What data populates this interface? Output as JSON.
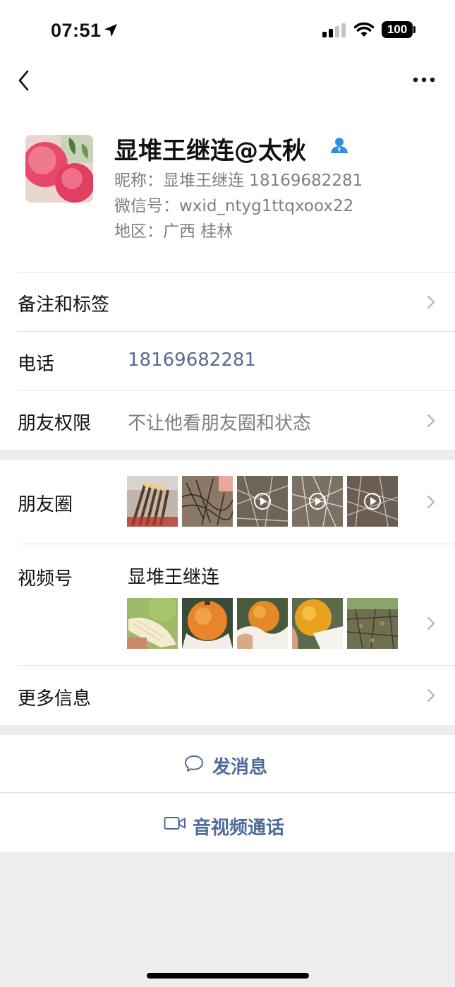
{
  "status_bar": {
    "time": "07:51",
    "battery": "100"
  },
  "profile": {
    "display_name": "显堆王继连@太秋",
    "nickname": "昵称：显堆王继连 18169682281",
    "wechat_id": "微信号：wxid_ntyg1ttqxoox22",
    "region": "地区：广西 桂林"
  },
  "rows": {
    "remarks_label": "备注和标签",
    "phone_label": "电话",
    "phone_value": "18169682281",
    "permission_label": "朋友权限",
    "permission_value": "不让他看朋友圈和状态",
    "moments_label": "朋友圈",
    "channels_label": "视频号",
    "channels_name": "显堆王继连",
    "more_label": "更多信息"
  },
  "actions": {
    "message_label": "发消息",
    "call_label": "音视频通话"
  },
  "colors": {
    "link": "#576b95",
    "action": "#4f6b9a",
    "gray_text": "#7f7f7f",
    "background": "#ededed"
  },
  "icons": [
    "back-icon",
    "more-icon",
    "location-arrow-icon",
    "signal-icon",
    "wifi-icon",
    "contact-badge-icon",
    "chevron-right-icon",
    "play-icon",
    "message-bubble-icon",
    "video-camera-icon"
  ]
}
